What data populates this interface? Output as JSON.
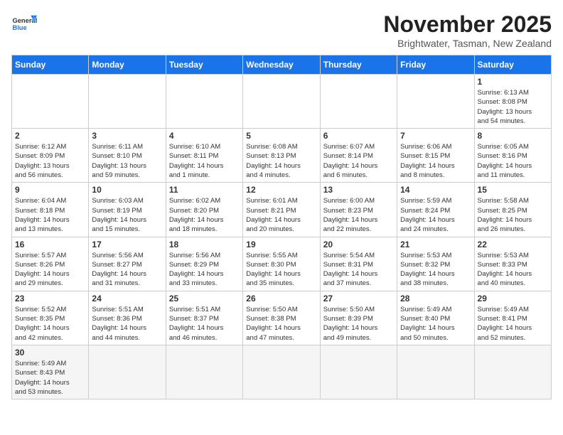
{
  "header": {
    "logo_line1": "General",
    "logo_line2": "Blue",
    "month": "November 2025",
    "location": "Brightwater, Tasman, New Zealand"
  },
  "days_of_week": [
    "Sunday",
    "Monday",
    "Tuesday",
    "Wednesday",
    "Thursday",
    "Friday",
    "Saturday"
  ],
  "weeks": [
    [
      {
        "day": "",
        "info": ""
      },
      {
        "day": "",
        "info": ""
      },
      {
        "day": "",
        "info": ""
      },
      {
        "day": "",
        "info": ""
      },
      {
        "day": "",
        "info": ""
      },
      {
        "day": "",
        "info": ""
      },
      {
        "day": "1",
        "info": "Sunrise: 6:13 AM\nSunset: 8:08 PM\nDaylight: 13 hours\nand 54 minutes."
      }
    ],
    [
      {
        "day": "2",
        "info": "Sunrise: 6:12 AM\nSunset: 8:09 PM\nDaylight: 13 hours\nand 56 minutes."
      },
      {
        "day": "3",
        "info": "Sunrise: 6:11 AM\nSunset: 8:10 PM\nDaylight: 13 hours\nand 59 minutes."
      },
      {
        "day": "4",
        "info": "Sunrise: 6:10 AM\nSunset: 8:11 PM\nDaylight: 14 hours\nand 1 minute."
      },
      {
        "day": "5",
        "info": "Sunrise: 6:08 AM\nSunset: 8:13 PM\nDaylight: 14 hours\nand 4 minutes."
      },
      {
        "day": "6",
        "info": "Sunrise: 6:07 AM\nSunset: 8:14 PM\nDaylight: 14 hours\nand 6 minutes."
      },
      {
        "day": "7",
        "info": "Sunrise: 6:06 AM\nSunset: 8:15 PM\nDaylight: 14 hours\nand 8 minutes."
      },
      {
        "day": "8",
        "info": "Sunrise: 6:05 AM\nSunset: 8:16 PM\nDaylight: 14 hours\nand 11 minutes."
      }
    ],
    [
      {
        "day": "9",
        "info": "Sunrise: 6:04 AM\nSunset: 8:18 PM\nDaylight: 14 hours\nand 13 minutes."
      },
      {
        "day": "10",
        "info": "Sunrise: 6:03 AM\nSunset: 8:19 PM\nDaylight: 14 hours\nand 15 minutes."
      },
      {
        "day": "11",
        "info": "Sunrise: 6:02 AM\nSunset: 8:20 PM\nDaylight: 14 hours\nand 18 minutes."
      },
      {
        "day": "12",
        "info": "Sunrise: 6:01 AM\nSunset: 8:21 PM\nDaylight: 14 hours\nand 20 minutes."
      },
      {
        "day": "13",
        "info": "Sunrise: 6:00 AM\nSunset: 8:23 PM\nDaylight: 14 hours\nand 22 minutes."
      },
      {
        "day": "14",
        "info": "Sunrise: 5:59 AM\nSunset: 8:24 PM\nDaylight: 14 hours\nand 24 minutes."
      },
      {
        "day": "15",
        "info": "Sunrise: 5:58 AM\nSunset: 8:25 PM\nDaylight: 14 hours\nand 26 minutes."
      }
    ],
    [
      {
        "day": "16",
        "info": "Sunrise: 5:57 AM\nSunset: 8:26 PM\nDaylight: 14 hours\nand 29 minutes."
      },
      {
        "day": "17",
        "info": "Sunrise: 5:56 AM\nSunset: 8:27 PM\nDaylight: 14 hours\nand 31 minutes."
      },
      {
        "day": "18",
        "info": "Sunrise: 5:56 AM\nSunset: 8:29 PM\nDaylight: 14 hours\nand 33 minutes."
      },
      {
        "day": "19",
        "info": "Sunrise: 5:55 AM\nSunset: 8:30 PM\nDaylight: 14 hours\nand 35 minutes."
      },
      {
        "day": "20",
        "info": "Sunrise: 5:54 AM\nSunset: 8:31 PM\nDaylight: 14 hours\nand 37 minutes."
      },
      {
        "day": "21",
        "info": "Sunrise: 5:53 AM\nSunset: 8:32 PM\nDaylight: 14 hours\nand 38 minutes."
      },
      {
        "day": "22",
        "info": "Sunrise: 5:53 AM\nSunset: 8:33 PM\nDaylight: 14 hours\nand 40 minutes."
      }
    ],
    [
      {
        "day": "23",
        "info": "Sunrise: 5:52 AM\nSunset: 8:35 PM\nDaylight: 14 hours\nand 42 minutes."
      },
      {
        "day": "24",
        "info": "Sunrise: 5:51 AM\nSunset: 8:36 PM\nDaylight: 14 hours\nand 44 minutes."
      },
      {
        "day": "25",
        "info": "Sunrise: 5:51 AM\nSunset: 8:37 PM\nDaylight: 14 hours\nand 46 minutes."
      },
      {
        "day": "26",
        "info": "Sunrise: 5:50 AM\nSunset: 8:38 PM\nDaylight: 14 hours\nand 47 minutes."
      },
      {
        "day": "27",
        "info": "Sunrise: 5:50 AM\nSunset: 8:39 PM\nDaylight: 14 hours\nand 49 minutes."
      },
      {
        "day": "28",
        "info": "Sunrise: 5:49 AM\nSunset: 8:40 PM\nDaylight: 14 hours\nand 50 minutes."
      },
      {
        "day": "29",
        "info": "Sunrise: 5:49 AM\nSunset: 8:41 PM\nDaylight: 14 hours\nand 52 minutes."
      }
    ],
    [
      {
        "day": "30",
        "info": "Sunrise: 5:49 AM\nSunset: 8:43 PM\nDaylight: 14 hours\nand 53 minutes."
      },
      {
        "day": "",
        "info": ""
      },
      {
        "day": "",
        "info": ""
      },
      {
        "day": "",
        "info": ""
      },
      {
        "day": "",
        "info": ""
      },
      {
        "day": "",
        "info": ""
      },
      {
        "day": "",
        "info": ""
      }
    ]
  ]
}
